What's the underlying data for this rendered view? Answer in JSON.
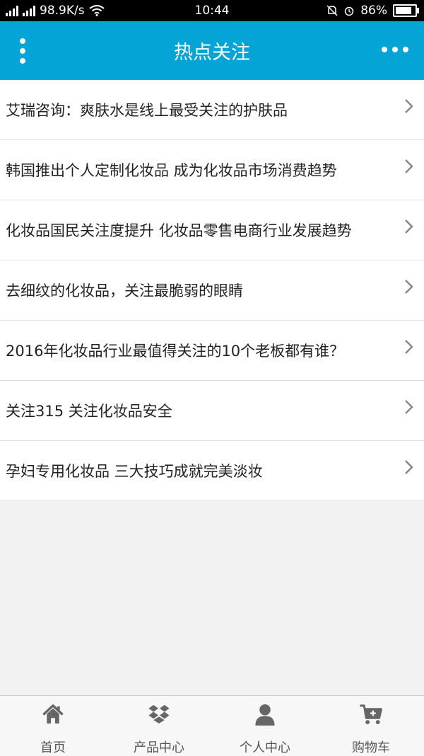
{
  "status_bar": {
    "network_speed": "98.9K/s",
    "sim1": "4G",
    "sim2": "2G",
    "time": "10:44",
    "battery": "86%",
    "battery_level": 0.86
  },
  "header": {
    "title": "热点关注"
  },
  "articles": [
    {
      "title": "艾瑞咨询：爽肤水是线上最受关注的护肤品"
    },
    {
      "title": "韩国推出个人定制化妆品 成为化妆品市场消费趋势"
    },
    {
      "title": "化妆品国民关注度提升 化妆品零售电商行业发展趋势"
    },
    {
      "title": "去细纹的化妆品，关注最脆弱的眼睛"
    },
    {
      "title": "2016年化妆品行业最值得关注的10个老板都有谁？"
    },
    {
      "title": "关注315 关注化妆品安全"
    },
    {
      "title": "孕妇专用化妆品 三大技巧成就完美淡妆"
    }
  ],
  "tabbar": {
    "home": "首页",
    "products": "产品中心",
    "profile": "个人中心",
    "cart": "购物车"
  },
  "colors": {
    "header_bg": "#05a4d6",
    "icon_gray": "#666666"
  },
  "icons": {
    "home": "house-icon",
    "products": "dropbox-icon",
    "profile": "user-icon",
    "cart": "cart-plus-icon"
  }
}
